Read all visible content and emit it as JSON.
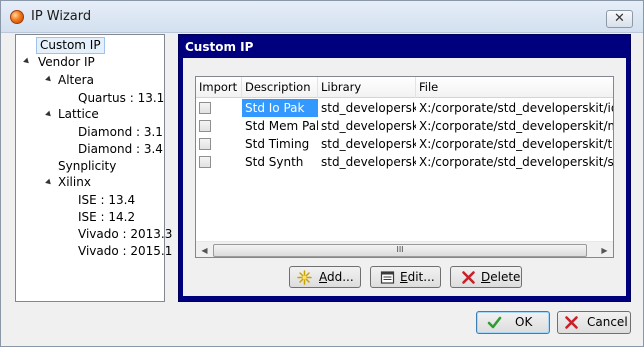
{
  "window": {
    "title": "IP Wizard",
    "close_glyph": "✕"
  },
  "tree": {
    "items": [
      {
        "label": "Custom IP",
        "level": 0,
        "expanded": false,
        "selected": true
      },
      {
        "label": "Vendor IP",
        "level": 0,
        "expanded": true
      },
      {
        "label": "Altera",
        "level": 1,
        "expanded": true
      },
      {
        "label": "Quartus : 13.1",
        "level": 2
      },
      {
        "label": "Lattice",
        "level": 1,
        "expanded": true
      },
      {
        "label": "Diamond : 3.1",
        "level": 2
      },
      {
        "label": "Diamond : 3.4",
        "level": 2
      },
      {
        "label": "Synplicity",
        "level": 1
      },
      {
        "label": "Xilinx",
        "level": 1,
        "expanded": true
      },
      {
        "label": "ISE : 13.4",
        "level": 2
      },
      {
        "label": "ISE : 14.2",
        "level": 2
      },
      {
        "label": "Vivado : 2013.3",
        "level": 2
      },
      {
        "label": "Vivado : 2015.1",
        "level": 2
      }
    ]
  },
  "panel": {
    "title": "Custom IP"
  },
  "table": {
    "columns": [
      "Import",
      "Description",
      "Library",
      "File"
    ],
    "rows": [
      {
        "import": false,
        "description": "Std Io Pak",
        "library": "std_developerskit",
        "file": "X:/corporate/std_developerskit/iopak",
        "selected": true
      },
      {
        "import": false,
        "description": "Std Mem Pak",
        "library": "std_developerskit",
        "file": "X:/corporate/std_developerskit/memp"
      },
      {
        "import": false,
        "description": "Std Timing",
        "library": "std_developerskit",
        "file": "X:/corporate/std_developerskit/timing"
      },
      {
        "import": false,
        "description": "Std Synth",
        "library": "std_developerskit",
        "file": "X:/corporate/std_developerskit/synth"
      }
    ],
    "scroll_grip": "III"
  },
  "actions": {
    "add": {
      "label_hot": "A",
      "label_rest": "dd...",
      "icon": "sparkle-icon"
    },
    "edit": {
      "label_hot": "E",
      "label_rest": "dit...",
      "icon": "edit-icon"
    },
    "delete": {
      "label_hot": "D",
      "label_rest": "elete",
      "icon": "delete-x-icon"
    }
  },
  "dialog": {
    "ok_label": "OK",
    "cancel_label": "Cancel"
  },
  "colors": {
    "panel_header": "#00007f",
    "selection": "#3399ff",
    "delete_red": "#c8202a",
    "ok_green": "#2f9e2f"
  }
}
